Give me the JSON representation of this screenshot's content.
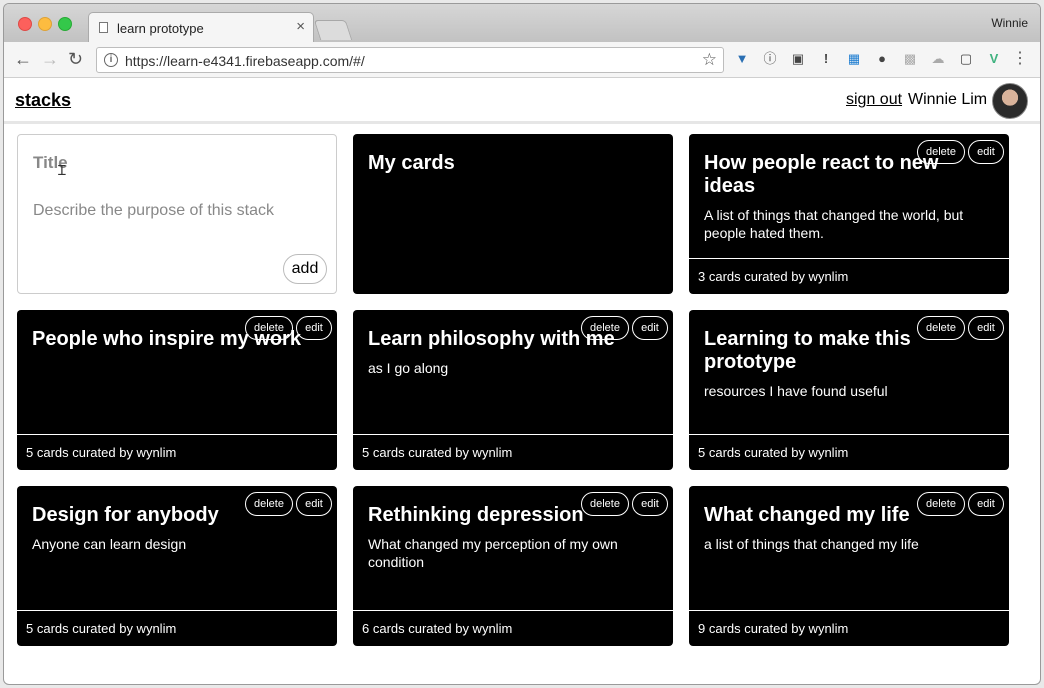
{
  "browser": {
    "tab_title": "learn prototype",
    "tab_close": "×",
    "profile_name": "Winnie",
    "url": "https://learn-e4341.firebaseapp.com/#/",
    "info_glyph": "i"
  },
  "app": {
    "brand": "stacks",
    "sign_out": "sign out",
    "user_name": "Winnie Lim"
  },
  "new_stack": {
    "title_placeholder": "Title",
    "description_placeholder": "Describe the purpose of this stack",
    "add_label": "add"
  },
  "card_actions": {
    "delete": "delete",
    "edit": "edit"
  },
  "stacks": [
    {
      "title": "My cards",
      "description": "",
      "footer": ""
    },
    {
      "title": "How people react to new ideas",
      "description": "A list of things that changed the world, but people hated them.",
      "footer": "3 cards curated by wynlim"
    },
    {
      "title": "People who inspire my work",
      "description": "",
      "footer": "5 cards curated by wynlim"
    },
    {
      "title": "Learn philosophy with me",
      "description": "as I go along",
      "footer": "5 cards curated by wynlim"
    },
    {
      "title": "Learning to make this prototype",
      "description": "resources I have found useful",
      "footer": "5 cards curated by wynlim"
    },
    {
      "title": "Design for anybody",
      "description": "Anyone can learn design",
      "footer": "5 cards curated by wynlim"
    },
    {
      "title": "Rethinking depression",
      "description": "What changed my perception of my own condition",
      "footer": "6 cards curated by wynlim"
    },
    {
      "title": "What changed my life",
      "description": "a list of things that changed my life",
      "footer": "9 cards curated by wynlim"
    }
  ]
}
